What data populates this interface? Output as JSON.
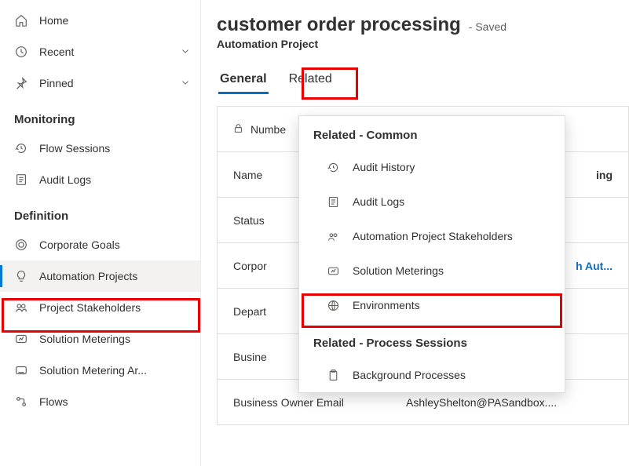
{
  "sidebar": {
    "top": [
      {
        "label": "Home",
        "expandable": false
      },
      {
        "label": "Recent",
        "expandable": true
      },
      {
        "label": "Pinned",
        "expandable": true
      }
    ],
    "groups": [
      {
        "title": "Monitoring",
        "items": [
          {
            "label": "Flow Sessions"
          },
          {
            "label": "Audit Logs"
          }
        ]
      },
      {
        "title": "Definition",
        "items": [
          {
            "label": "Corporate Goals"
          },
          {
            "label": "Automation Projects",
            "selected": true
          },
          {
            "label": "Project Stakeholders"
          },
          {
            "label": "Solution Meterings"
          },
          {
            "label": "Solution Metering Ar..."
          },
          {
            "label": "Flows"
          }
        ]
      }
    ]
  },
  "header": {
    "title": "customer order processing",
    "status": "- Saved",
    "subtitle": "Automation Project"
  },
  "tabs": {
    "general": "General",
    "related": "Related"
  },
  "form": {
    "rows": [
      {
        "label": "Numbe",
        "locked": true
      },
      {
        "label": "Name",
        "value": "ing",
        "bold": true
      },
      {
        "label": "Status"
      },
      {
        "label": "Corpor",
        "value": "h Aut...",
        "link": true
      },
      {
        "label": "Depart"
      },
      {
        "label": "Busine"
      },
      {
        "label": "Business Owner Email",
        "value": "AshleyShelton@PASandbox...."
      }
    ]
  },
  "dropdown": {
    "section1": "Related - Common",
    "section2": "Related - Process Sessions",
    "items": [
      "Audit History",
      "Audit Logs",
      "Automation Project Stakeholders",
      "Solution Meterings",
      "Environments"
    ],
    "items2": [
      "Background Processes"
    ]
  }
}
